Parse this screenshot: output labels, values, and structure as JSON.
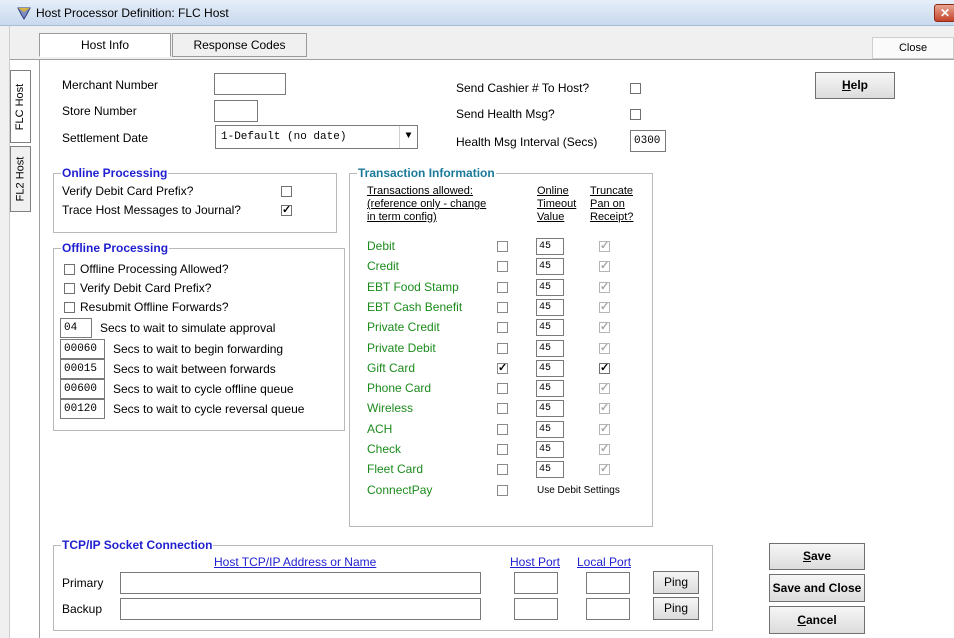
{
  "window": {
    "title": "Host Processor Definition: FLC Host",
    "close_glyph": "✕"
  },
  "top_tabs": [
    {
      "label": "Host Info"
    },
    {
      "label": "Response Codes"
    }
  ],
  "close_label": "Close",
  "side_tabs": [
    {
      "label": "FLC Host"
    },
    {
      "label": "FL2 Host"
    }
  ],
  "host": {
    "merchant_number": {
      "label": "Merchant Number",
      "value": ""
    },
    "store_number": {
      "label": "Store Number",
      "value": ""
    },
    "settlement_date": {
      "label": "Settlement Date",
      "value": "1-Default (no date)"
    },
    "send_cashier": {
      "label": "Send Cashier # To Host?",
      "checked": false
    },
    "send_health": {
      "label": "Send Health Msg?",
      "checked": false
    },
    "health_interval": {
      "label": "Health Msg Interval (Secs)",
      "value": "0300"
    }
  },
  "help_button": {
    "label_hotkey": "H",
    "label_rest": "elp"
  },
  "online": {
    "title": "Online Processing",
    "items": [
      {
        "label": "Verify Debit Card Prefix?",
        "checked": false
      },
      {
        "label": "Trace Host Messages to Journal?",
        "checked": true
      }
    ]
  },
  "offline": {
    "title": "Offline Processing",
    "checks": [
      {
        "label": "Offline Processing Allowed?",
        "checked": false
      },
      {
        "label": "Verify Debit Card Prefix?",
        "checked": false
      },
      {
        "label": "Resubmit Offline Forwards?",
        "checked": false
      }
    ],
    "fields": [
      {
        "value": "04",
        "label": "Secs to wait to simulate approval"
      },
      {
        "value": "00060",
        "label": "Secs to wait to begin forwarding"
      },
      {
        "value": "00015",
        "label": "Secs to wait between forwards"
      },
      {
        "value": "00600",
        "label": "Secs to wait to cycle offline queue"
      },
      {
        "value": "00120",
        "label": "Secs to wait to cycle reversal queue"
      }
    ]
  },
  "transactions": {
    "title": "Transaction Information",
    "header_allowed": [
      "Transactions allowed:",
      "(reference only - change",
      "in term config)"
    ],
    "header_timeout": [
      "Online",
      "Timeout",
      "Value"
    ],
    "header_truncate": [
      "Truncate",
      "Pan on",
      "Receipt?"
    ],
    "rows": [
      {
        "name": "Debit",
        "allowed": false,
        "timeout": "45",
        "truncate": true
      },
      {
        "name": "Credit",
        "allowed": false,
        "timeout": "45",
        "truncate": true
      },
      {
        "name": "EBT Food Stamp",
        "allowed": false,
        "timeout": "45",
        "truncate": true
      },
      {
        "name": "EBT Cash Benefit",
        "allowed": false,
        "timeout": "45",
        "truncate": true
      },
      {
        "name": "Private Credit",
        "allowed": false,
        "timeout": "45",
        "truncate": true
      },
      {
        "name": "Private Debit",
        "allowed": false,
        "timeout": "45",
        "truncate": true
      },
      {
        "name": "Gift Card",
        "allowed": true,
        "timeout": "45",
        "truncate": true
      },
      {
        "name": "Phone Card",
        "allowed": false,
        "timeout": "45",
        "truncate": true
      },
      {
        "name": "Wireless",
        "allowed": false,
        "timeout": "45",
        "truncate": true
      },
      {
        "name": "ACH",
        "allowed": false,
        "timeout": "45",
        "truncate": true
      },
      {
        "name": "Check",
        "allowed": false,
        "timeout": "45",
        "truncate": true
      },
      {
        "name": "Fleet Card",
        "allowed": false,
        "timeout": "45",
        "truncate": true
      },
      {
        "name": "ConnectPay",
        "allowed": false,
        "note": "Use Debit Settings"
      }
    ]
  },
  "tcpip": {
    "title": "TCP/IP Socket Connection",
    "header_address": "Host TCP/IP Address or Name",
    "header_host_port": "Host Port",
    "header_local_port": "Local Port",
    "rows": [
      {
        "label": "Primary",
        "address": "",
        "host_port": "",
        "local_port": "",
        "ping": "Ping"
      },
      {
        "label": "Backup",
        "address": "",
        "host_port": "",
        "local_port": "",
        "ping": "Ping"
      }
    ]
  },
  "actions": {
    "save": {
      "hotkey": "S",
      "rest": "ave"
    },
    "save_close": {
      "label": "Save and Close"
    },
    "cancel": {
      "hotkey": "C",
      "rest": "ancel"
    }
  }
}
